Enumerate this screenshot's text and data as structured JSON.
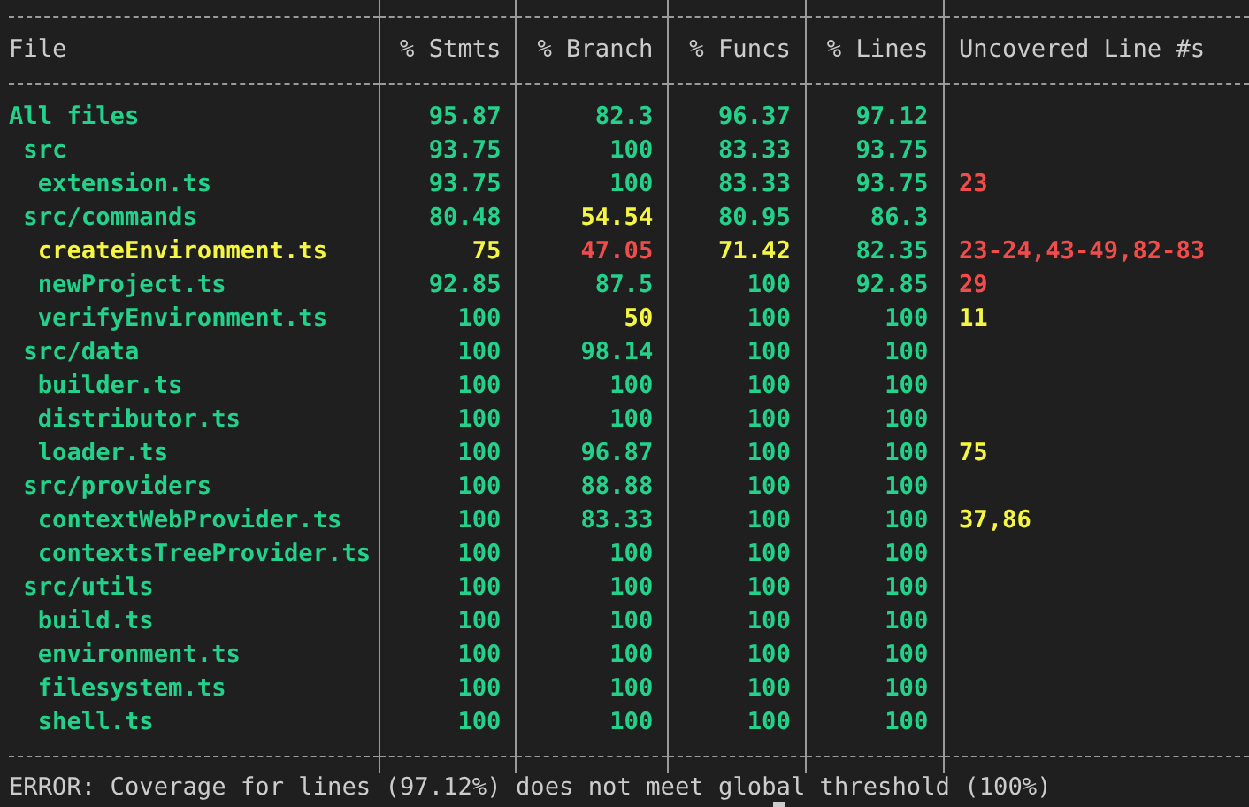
{
  "table": {
    "columns": [
      "File",
      "% Stmts",
      "% Branch",
      "% Funcs",
      "% Lines",
      "Uncovered Line #s"
    ],
    "rows": [
      {
        "cells": [
          {
            "text": "All files",
            "color": "#23d18b"
          },
          {
            "text": "95.87",
            "color": "#23d18b"
          },
          {
            "text": "82.3",
            "color": "#23d18b"
          },
          {
            "text": "96.37",
            "color": "#23d18b"
          },
          {
            "text": "97.12",
            "color": "#23d18b"
          }
        ],
        "children": [
          {
            "cells": [
              {
                "text": "src",
                "color": "#23d18b"
              },
              {
                "text": "93.75",
                "color": "#23d18b"
              },
              {
                "text": "100",
                "color": "#23d18b"
              },
              {
                "text": "83.33",
                "color": "#23d18b"
              },
              {
                "text": "93.75",
                "color": "#23d18b"
              }
            ],
            "children": [
              {
                "cells": [
                  {
                    "text": "extension.ts",
                    "color": "#23d18b"
                  },
                  {
                    "text": "93.75",
                    "color": "#23d18b"
                  },
                  {
                    "text": "100",
                    "color": "#23d18b"
                  },
                  {
                    "text": "83.33",
                    "color": "#23d18b"
                  },
                  {
                    "text": "93.75",
                    "color": "#23d18b"
                  },
                  {
                    "text": "23",
                    "color": "#f14c4c"
                  }
                ]
              }
            ]
          },
          {
            "cells": [
              {
                "text": "src/commands",
                "color": "#23d18b"
              },
              {
                "text": "80.48",
                "color": "#23d18b"
              },
              {
                "text": "54.54",
                "color": "#f5f543"
              },
              {
                "text": "80.95",
                "color": "#23d18b"
              },
              {
                "text": "86.3",
                "color": "#23d18b"
              }
            ],
            "children": [
              {
                "cells": [
                  {
                    "text": "createEnvironment.ts",
                    "color": "#f5f543"
                  },
                  {
                    "text": "75",
                    "color": "#f5f543"
                  },
                  {
                    "text": "47.05",
                    "color": "#f14c4c"
                  },
                  {
                    "text": "71.42",
                    "color": "#f5f543"
                  },
                  {
                    "text": "82.35",
                    "color": "#23d18b"
                  },
                  {
                    "text": "23-24,43-49,82-83",
                    "color": "#f14c4c"
                  }
                ]
              },
              {
                "cells": [
                  {
                    "text": "newProject.ts",
                    "color": "#23d18b"
                  },
                  {
                    "text": "92.85",
                    "color": "#23d18b"
                  },
                  {
                    "text": "87.5",
                    "color": "#23d18b"
                  },
                  {
                    "text": "100",
                    "color": "#23d18b"
                  },
                  {
                    "text": "92.85",
                    "color": "#23d18b"
                  },
                  {
                    "text": "29",
                    "color": "#f14c4c"
                  }
                ]
              },
              {
                "cells": [
                  {
                    "text": "verifyEnvironment.ts",
                    "color": "#23d18b"
                  },
                  {
                    "text": "100",
                    "color": "#23d18b"
                  },
                  {
                    "text": "50",
                    "color": "#f5f543"
                  },
                  {
                    "text": "100",
                    "color": "#23d18b"
                  },
                  {
                    "text": "100",
                    "color": "#23d18b"
                  },
                  {
                    "text": "11",
                    "color": "#f5f543"
                  }
                ]
              }
            ]
          },
          {
            "cells": [
              {
                "text": "src/data",
                "color": "#23d18b"
              },
              {
                "text": "100",
                "color": "#23d18b"
              },
              {
                "text": "98.14",
                "color": "#23d18b"
              },
              {
                "text": "100",
                "color": "#23d18b"
              },
              {
                "text": "100",
                "color": "#23d18b"
              }
            ],
            "children": [
              {
                "cells": [
                  {
                    "text": "builder.ts",
                    "color": "#23d18b"
                  },
                  {
                    "text": "100",
                    "color": "#23d18b"
                  },
                  {
                    "text": "100",
                    "color": "#23d18b"
                  },
                  {
                    "text": "100",
                    "color": "#23d18b"
                  },
                  {
                    "text": "100",
                    "color": "#23d18b"
                  }
                ]
              },
              {
                "cells": [
                  {
                    "text": "distributor.ts",
                    "color": "#23d18b"
                  },
                  {
                    "text": "100",
                    "color": "#23d18b"
                  },
                  {
                    "text": "100",
                    "color": "#23d18b"
                  },
                  {
                    "text": "100",
                    "color": "#23d18b"
                  },
                  {
                    "text": "100",
                    "color": "#23d18b"
                  }
                ]
              },
              {
                "cells": [
                  {
                    "text": "loader.ts",
                    "color": "#23d18b"
                  },
                  {
                    "text": "100",
                    "color": "#23d18b"
                  },
                  {
                    "text": "96.87",
                    "color": "#23d18b"
                  },
                  {
                    "text": "100",
                    "color": "#23d18b"
                  },
                  {
                    "text": "100",
                    "color": "#23d18b"
                  },
                  {
                    "text": "75",
                    "color": "#f5f543"
                  }
                ]
              }
            ]
          },
          {
            "cells": [
              {
                "text": "src/providers",
                "color": "#23d18b"
              },
              {
                "text": "100",
                "color": "#23d18b"
              },
              {
                "text": "88.88",
                "color": "#23d18b"
              },
              {
                "text": "100",
                "color": "#23d18b"
              },
              {
                "text": "100",
                "color": "#23d18b"
              }
            ],
            "children": [
              {
                "cells": [
                  {
                    "text": "contextWebProvider.ts",
                    "color": "#23d18b"
                  },
                  {
                    "text": "100",
                    "color": "#23d18b"
                  },
                  {
                    "text": "83.33",
                    "color": "#23d18b"
                  },
                  {
                    "text": "100",
                    "color": "#23d18b"
                  },
                  {
                    "text": "100",
                    "color": "#23d18b"
                  },
                  {
                    "text": "37,86",
                    "color": "#f5f543"
                  }
                ]
              },
              {
                "cells": [
                  {
                    "text": "contextsTreeProvider.ts",
                    "color": "#23d18b"
                  },
                  {
                    "text": "100",
                    "color": "#23d18b"
                  },
                  {
                    "text": "100",
                    "color": "#23d18b"
                  },
                  {
                    "text": "100",
                    "color": "#23d18b"
                  },
                  {
                    "text": "100",
                    "color": "#23d18b"
                  }
                ]
              }
            ]
          },
          {
            "cells": [
              {
                "text": "src/utils",
                "color": "#23d18b"
              },
              {
                "text": "100",
                "color": "#23d18b"
              },
              {
                "text": "100",
                "color": "#23d18b"
              },
              {
                "text": "100",
                "color": "#23d18b"
              },
              {
                "text": "100",
                "color": "#23d18b"
              }
            ],
            "children": [
              {
                "cells": [
                  {
                    "text": "build.ts",
                    "color": "#23d18b"
                  },
                  {
                    "text": "100",
                    "color": "#23d18b"
                  },
                  {
                    "text": "100",
                    "color": "#23d18b"
                  },
                  {
                    "text": "100",
                    "color": "#23d18b"
                  },
                  {
                    "text": "100",
                    "color": "#23d18b"
                  }
                ]
              },
              {
                "cells": [
                  {
                    "text": "environment.ts",
                    "color": "#23d18b"
                  },
                  {
                    "text": "100",
                    "color": "#23d18b"
                  },
                  {
                    "text": "100",
                    "color": "#23d18b"
                  },
                  {
                    "text": "100",
                    "color": "#23d18b"
                  },
                  {
                    "text": "100",
                    "color": "#23d18b"
                  }
                ]
              },
              {
                "cells": [
                  {
                    "text": "filesystem.ts",
                    "color": "#23d18b"
                  },
                  {
                    "text": "100",
                    "color": "#23d18b"
                  },
                  {
                    "text": "100",
                    "color": "#23d18b"
                  },
                  {
                    "text": "100",
                    "color": "#23d18b"
                  },
                  {
                    "text": "100",
                    "color": "#23d18b"
                  }
                ]
              },
              {
                "cells": [
                  {
                    "text": "shell.ts",
                    "color": "#23d18b"
                  },
                  {
                    "text": "100",
                    "color": "#23d18b"
                  },
                  {
                    "text": "100",
                    "color": "#23d18b"
                  },
                  {
                    "text": "100",
                    "color": "#23d18b"
                  },
                  {
                    "text": "100",
                    "color": "#23d18b"
                  }
                ]
              }
            ]
          }
        ]
      }
    ]
  },
  "error_message": "ERROR: Coverage for lines (97.12%) does not meet global threshold (100%)"
}
